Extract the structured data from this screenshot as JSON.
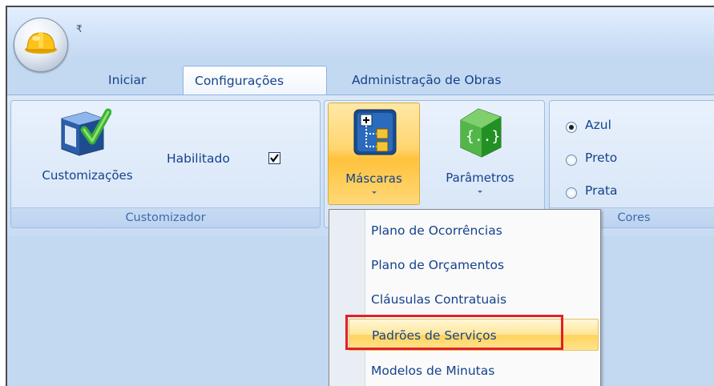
{
  "app": {
    "quick_access": "₹"
  },
  "tabs": [
    {
      "label": "Iniciar",
      "active": false
    },
    {
      "label": "Configurações",
      "active": true
    },
    {
      "label": "Administração de Obras",
      "active": false
    }
  ],
  "groups": {
    "customizador": {
      "label": "Customizador",
      "customizacoes_label": "Customizações",
      "habilitado_label": "Habilitado",
      "habilitado_checked": true
    },
    "mascaras_group": {
      "mascaras_label": "Máscaras",
      "parametros_label": "Parâmetros"
    },
    "cores": {
      "label": "Cores",
      "options": [
        {
          "label": "Azul",
          "selected": true
        },
        {
          "label": "Preto",
          "selected": false
        },
        {
          "label": "Prata",
          "selected": false
        }
      ]
    }
  },
  "menu": {
    "items": [
      "Plano de Ocorrências",
      "Plano de Orçamentos",
      "Cláusulas Contratuais",
      "Padrões de Serviços",
      "Modelos de Minutas"
    ],
    "highlighted_index": 3
  },
  "colors": {
    "accent": "#15428b",
    "highlight": "#ffd56f",
    "annotation": "#e32026"
  }
}
